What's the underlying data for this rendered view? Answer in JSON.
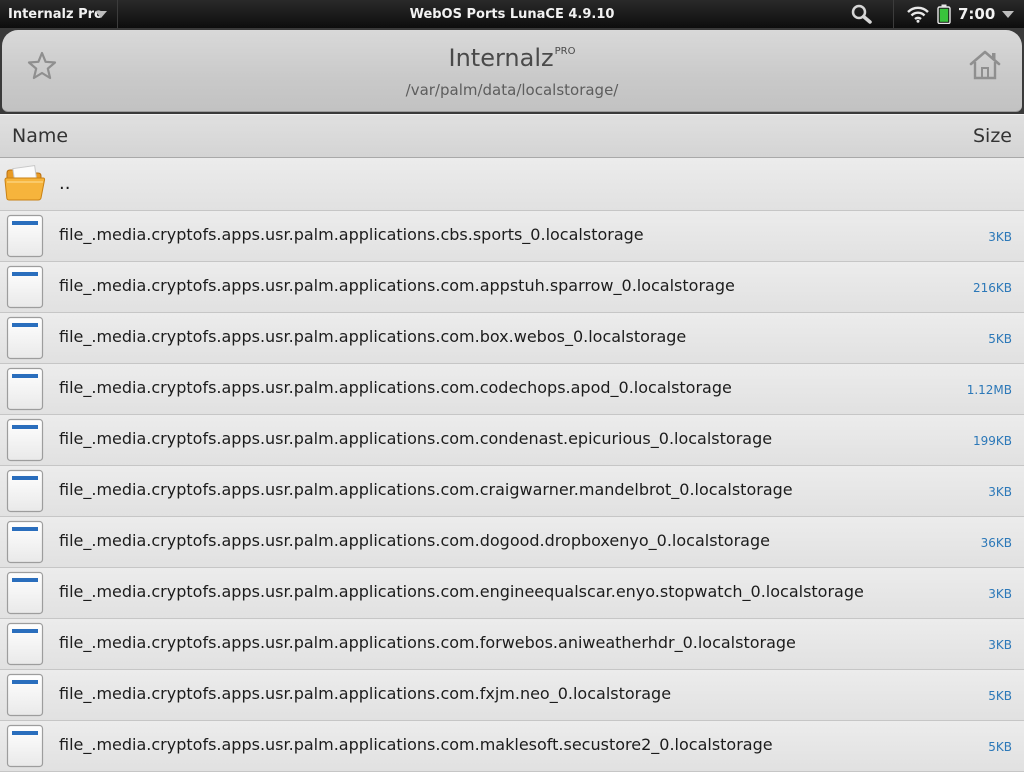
{
  "statusbar": {
    "app_name": "Internalz Pro",
    "system_title": "WebOS Ports LunaCE 4.9.10",
    "clock": "7:00"
  },
  "header": {
    "title": "Internalz",
    "title_badge": "PRO",
    "path": "/var/palm/data/localstorage/"
  },
  "columns": {
    "name_label": "Name",
    "size_label": "Size"
  },
  "list": {
    "parent_label": "..",
    "files": [
      {
        "name": "file_.media.cryptofs.apps.usr.palm.applications.cbs.sports_0.localstorage",
        "size": "3KB"
      },
      {
        "name": "file_.media.cryptofs.apps.usr.palm.applications.com.appstuh.sparrow_0.localstorage",
        "size": "216KB"
      },
      {
        "name": "file_.media.cryptofs.apps.usr.palm.applications.com.box.webos_0.localstorage",
        "size": "5KB"
      },
      {
        "name": "file_.media.cryptofs.apps.usr.palm.applications.com.codechops.apod_0.localstorage",
        "size": "1.12MB"
      },
      {
        "name": "file_.media.cryptofs.apps.usr.palm.applications.com.condenast.epicurious_0.localstorage",
        "size": "199KB"
      },
      {
        "name": "file_.media.cryptofs.apps.usr.palm.applications.com.craigwarner.mandelbrot_0.localstorage",
        "size": "3KB"
      },
      {
        "name": "file_.media.cryptofs.apps.usr.palm.applications.com.dogood.dropboxenyo_0.localstorage",
        "size": "36KB"
      },
      {
        "name": "file_.media.cryptofs.apps.usr.palm.applications.com.engineequalscar.enyo.stopwatch_0.localstorage",
        "size": "3KB"
      },
      {
        "name": "file_.media.cryptofs.apps.usr.palm.applications.com.forwebos.aniweatherhdr_0.localstorage",
        "size": "3KB"
      },
      {
        "name": "file_.media.cryptofs.apps.usr.palm.applications.com.fxjm.neo_0.localstorage",
        "size": "5KB"
      },
      {
        "name": "file_.media.cryptofs.apps.usr.palm.applications.com.maklesoft.secustore2_0.localstorage",
        "size": "5KB"
      }
    ]
  },
  "icons": {
    "search": "search-icon",
    "wifi": "wifi-icon",
    "battery": "battery-icon",
    "star": "star-icon",
    "home": "home-icon",
    "folder": "folder-icon",
    "file": "file-icon"
  },
  "colors": {
    "size_text": "#2c78b8",
    "battery_fill": "#39c43c"
  }
}
